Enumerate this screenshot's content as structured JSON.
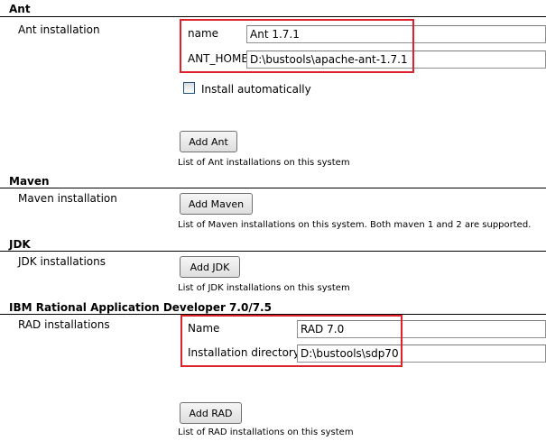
{
  "ant": {
    "section_title": "Ant",
    "row_label": "Ant installation",
    "name_label": "name",
    "name_value": "Ant 1.7.1",
    "home_label": "ANT_HOME",
    "home_value": "D:\\bustools\\apache-ant-1.7.1",
    "install_auto_label": "Install automatically",
    "install_auto_checked": false,
    "add_button": "Add Ant",
    "description": "List of Ant installations on this system"
  },
  "maven": {
    "section_title": "Maven",
    "row_label": "Maven installation",
    "add_button": "Add Maven",
    "description": "List of Maven installations on this system. Both maven 1 and 2 are supported."
  },
  "jdk": {
    "section_title": "JDK",
    "row_label": "JDK installations",
    "add_button": "Add JDK",
    "description": "List of JDK installations on this system"
  },
  "rad": {
    "section_title": "IBM Rational Application Developer 7.0/7.5",
    "row_label": "RAD installations",
    "name_label": "Name",
    "name_value": "RAD 7.0",
    "dir_label": "Installation directory",
    "dir_value": "D:\\bustools\\sdp70",
    "add_button": "Add RAD",
    "description": "List of RAD installations on this system"
  },
  "colors": {
    "highlight_border": "#e0212b",
    "section_rule": "#000000"
  }
}
